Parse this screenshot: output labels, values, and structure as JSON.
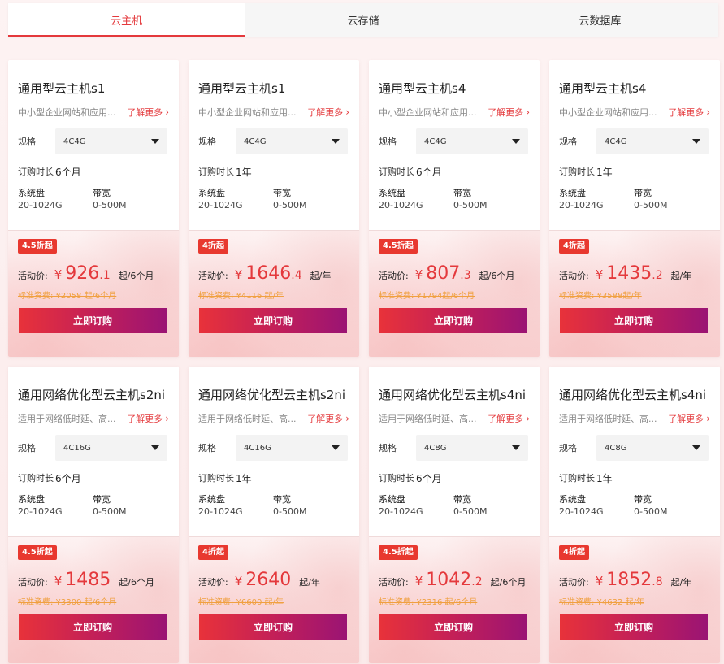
{
  "tabs": [
    {
      "label": "云主机",
      "active": true
    },
    {
      "label": "云存储",
      "active": false
    },
    {
      "label": "云数据库",
      "active": false
    }
  ],
  "common": {
    "more_label": "了解更多",
    "spec_label": "规格",
    "duration_label": "订购时长",
    "disk_label": "系统盘",
    "disk_value": "20-1024G",
    "bw_label": "带宽",
    "bw_value": "0-500M",
    "price_label": "活动价:",
    "yen": "¥",
    "buy_label": "立即订购"
  },
  "colors": {
    "accent": "#e4393c",
    "badge": "#e8382f",
    "strike": "#f0a040",
    "buy_from": "#e8323a",
    "buy_to": "#9a1474"
  },
  "cards": [
    {
      "title": "通用型云主机s1",
      "desc": "中小型企业网站和应用...",
      "spec": "4C4G",
      "duration": "6个月",
      "badge": "4.5折起",
      "price_int": "926",
      "price_dec": ".1",
      "per": "起/6个月",
      "std": "标准资费: ¥2058 起/6个月"
    },
    {
      "title": "通用型云主机s1",
      "desc": "中小型企业网站和应用...",
      "spec": "4C4G",
      "duration": "1年",
      "badge": "4折起",
      "price_int": "1646",
      "price_dec": ".4",
      "per": "起/年",
      "std": "标准资费: ¥4116 起/年"
    },
    {
      "title": "通用型云主机s4",
      "desc": "中小型企业网站和应用...",
      "spec": "4C4G",
      "duration": "6个月",
      "badge": "4.5折起",
      "price_int": "807",
      "price_dec": ".3",
      "per": "起/6个月",
      "std": "标准资费: ¥1794起/6个月"
    },
    {
      "title": "通用型云主机s4",
      "desc": "中小型企业网站和应用...",
      "spec": "4C4G",
      "duration": "1年",
      "badge": "4折起",
      "price_int": "1435",
      "price_dec": ".2",
      "per": "起/年",
      "std": "标准资费: ¥3588起/年"
    },
    {
      "title": "通用网络优化型云主机s2ni",
      "desc": "适用于网络低时延、高...",
      "spec": "4C16G",
      "duration": "6个月",
      "badge": "4.5折起",
      "price_int": "1485",
      "price_dec": "",
      "per": "起/6个月",
      "std": "标准资费: ¥3300 起/6个月"
    },
    {
      "title": "通用网络优化型云主机s2ni",
      "desc": "适用于网络低时延、高...",
      "spec": "4C16G",
      "duration": "1年",
      "badge": "4折起",
      "price_int": "2640",
      "price_dec": "",
      "per": "起/年",
      "std": "标准资费: ¥6600 起/年"
    },
    {
      "title": "通用网络优化型云主机s4ni",
      "desc": "适用于网络低时延、高...",
      "spec": "4C8G",
      "duration": "6个月",
      "badge": "4.5折起",
      "price_int": "1042",
      "price_dec": ".2",
      "per": "起/6个月",
      "std": "标准资费: ¥2316 起/6个月"
    },
    {
      "title": "通用网络优化型云主机s4ni",
      "desc": "适用于网络低时延、高...",
      "spec": "4C8G",
      "duration": "1年",
      "badge": "4折起",
      "price_int": "1852",
      "price_dec": ".8",
      "per": "起/年",
      "std": "标准资费: ¥4632 起/年"
    }
  ]
}
